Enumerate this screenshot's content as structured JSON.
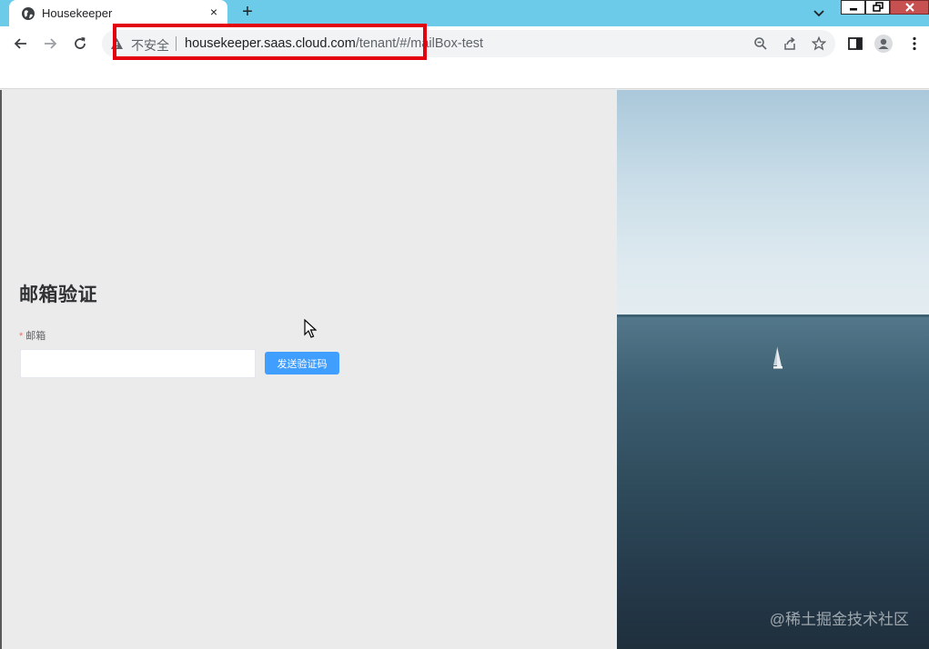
{
  "browser": {
    "tab_title": "Housekeeper",
    "tab_close": "×",
    "new_tab": "+",
    "security_label": "不安全",
    "url_host": "housekeeper.saas.cloud.com",
    "url_path": "/tenant/#/mailBox-test"
  },
  "page": {
    "heading": "邮箱验证",
    "email_required_mark": "*",
    "email_label": "邮箱",
    "email_value": "",
    "send_code_button": "发送验证码",
    "watermark": "@稀土掘金技术社区"
  },
  "colors": {
    "titlebar": "#6bcbe9",
    "highlight": "#e3000f",
    "primary_button": "#409eff",
    "page_background": "#ebebeb"
  },
  "icons": [
    "globe-icon",
    "close-icon",
    "plus-icon",
    "chevron-down-icon",
    "back-arrow-icon",
    "forward-arrow-icon",
    "reload-icon",
    "warning-icon",
    "zoom-icon",
    "share-icon",
    "star-icon",
    "side-panel-icon",
    "profile-icon",
    "more-menu-icon",
    "mouse-cursor-icon"
  ]
}
